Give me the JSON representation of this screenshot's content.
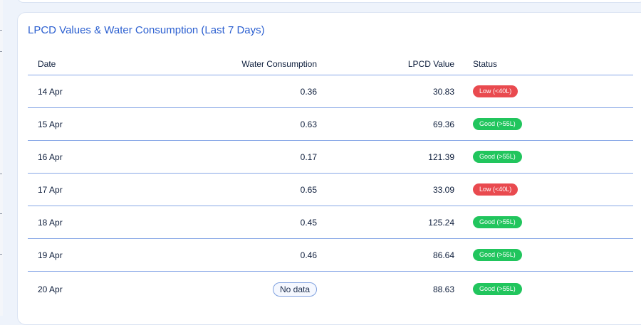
{
  "card": {
    "title": "LPCD Values & Water Consumption (Last 7 Days)"
  },
  "table": {
    "headers": {
      "date": "Date",
      "water_consumption": "Water Consumption",
      "lpcd_value": "LPCD Value",
      "status": "Status"
    },
    "rows": [
      {
        "date": "14 Apr",
        "water_consumption": "0.36",
        "lpcd_value": "30.83",
        "status": "Low (<40L)",
        "status_kind": "low"
      },
      {
        "date": "15 Apr",
        "water_consumption": "0.63",
        "lpcd_value": "69.36",
        "status": "Good (>55L)",
        "status_kind": "good"
      },
      {
        "date": "16 Apr",
        "water_consumption": "0.17",
        "lpcd_value": "121.39",
        "status": "Good (>55L)",
        "status_kind": "good"
      },
      {
        "date": "17 Apr",
        "water_consumption": "0.65",
        "lpcd_value": "33.09",
        "status": "Low (<40L)",
        "status_kind": "low"
      },
      {
        "date": "18 Apr",
        "water_consumption": "0.45",
        "lpcd_value": "125.24",
        "status": "Good (>55L)",
        "status_kind": "good"
      },
      {
        "date": "19 Apr",
        "water_consumption": "0.46",
        "lpcd_value": "86.64",
        "status": "Good (>55L)",
        "status_kind": "good"
      },
      {
        "date": "20 Apr",
        "water_consumption": "No data",
        "lpcd_value": "88.63",
        "status": "Good (>55L)",
        "status_kind": "good"
      }
    ]
  },
  "colors": {
    "title": "#2b5fd0",
    "low_badge": "#e94a4f",
    "good_badge": "#21c55d",
    "row_divider": "#86a6e6"
  }
}
